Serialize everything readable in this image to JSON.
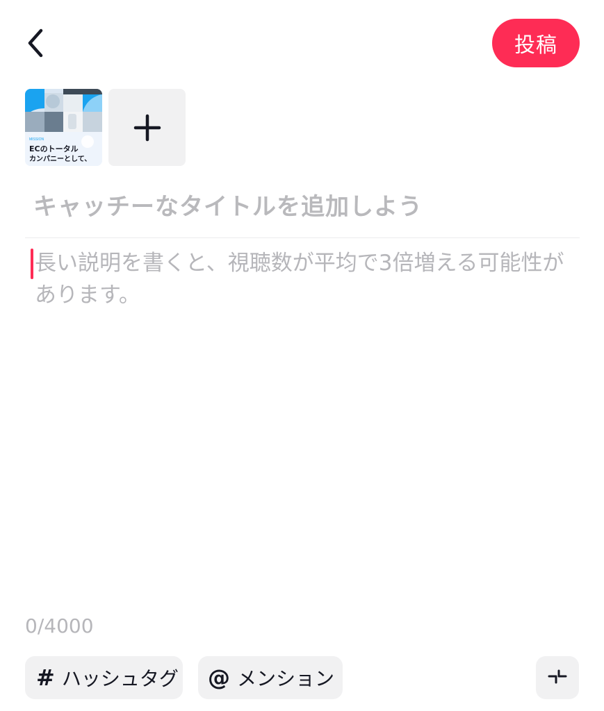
{
  "header": {
    "back_icon": "chevron-left-icon",
    "post_label": "投稿"
  },
  "media": {
    "thumbnail": {
      "tag_text": "MISSION",
      "line1": "ECのトータル",
      "line2": "カンパニーとして、"
    },
    "add_icon": "plus-icon"
  },
  "title": {
    "placeholder": "キャッチーなタイトルを追加しよう"
  },
  "description": {
    "placeholder": "長い説明を書くと、視聴数が平均で3倍増える可能性があります。"
  },
  "counter": "0/4000",
  "toolbar": {
    "hashtag_icon": "#",
    "hashtag_label": "ハッシュタグ",
    "mention_icon": "@",
    "mention_label": "メンション",
    "collapse_icon": "collapse-icon"
  },
  "colors": {
    "accent": "#fe2c55",
    "chip_bg": "#f1f1f2",
    "placeholder": "#b6b6ba"
  }
}
